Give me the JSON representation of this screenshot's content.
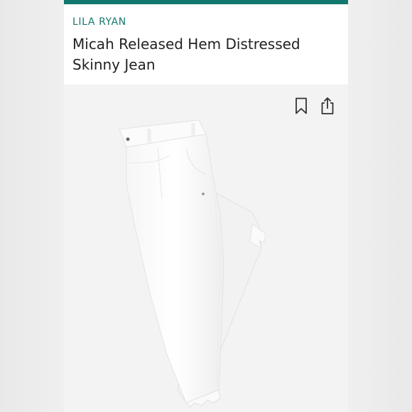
{
  "brand": {
    "name": "LILA RYAN"
  },
  "product": {
    "title_line1": "Micah Released Hem Distressed",
    "title_line2": "Skinny Jean"
  },
  "icons": {
    "bookmark": "bookmark-icon",
    "share": "share-icon"
  },
  "colors": {
    "accent": "#11786e",
    "brand_text": "#1a7a70",
    "title_text": "#222222",
    "image_bg": "#f3f3f3"
  }
}
